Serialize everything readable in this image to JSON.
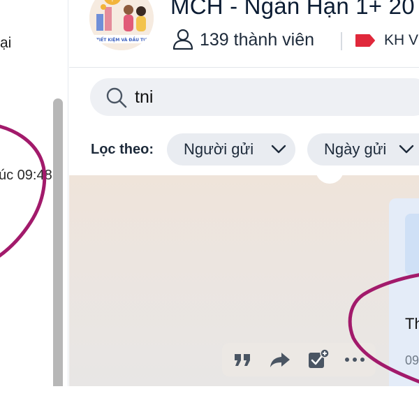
{
  "sidebar": {
    "conversation_fragment_text": "ại",
    "conversation_time_text": "úc 09:48"
  },
  "header": {
    "group_title": "MCH - Ngắn Hạn 1+ 20",
    "member_count": "139 thành viên",
    "tag_label": "KH V",
    "avatar": {
      "icon": "group-avatar-image",
      "caption": "TIẾT KIỆM VÀ ĐẦU TƯ",
      "symbol": "$"
    }
  },
  "search": {
    "value": "tni",
    "icon": "search-icon"
  },
  "filters": {
    "label": "Lọc theo:",
    "chips": [
      {
        "label": "Người gửi",
        "icon": "chevron-down-icon"
      },
      {
        "label": "Ngày gửi",
        "icon": "chevron-down-icon"
      }
    ]
  },
  "message": {
    "text": "Th",
    "time": "09"
  },
  "message_toolbar": {
    "icons": [
      "quote-icon",
      "forward-icon",
      "add-task-icon",
      "more-icon"
    ]
  },
  "colors": {
    "annotation_pen": "#a21a6b",
    "tag_red": "#e0283b",
    "scrollbar": "#b7b7b7",
    "chip_bg": "#e9ecf1",
    "search_bg": "#eef0f4",
    "bubble_bg": "#e4ecf8"
  }
}
